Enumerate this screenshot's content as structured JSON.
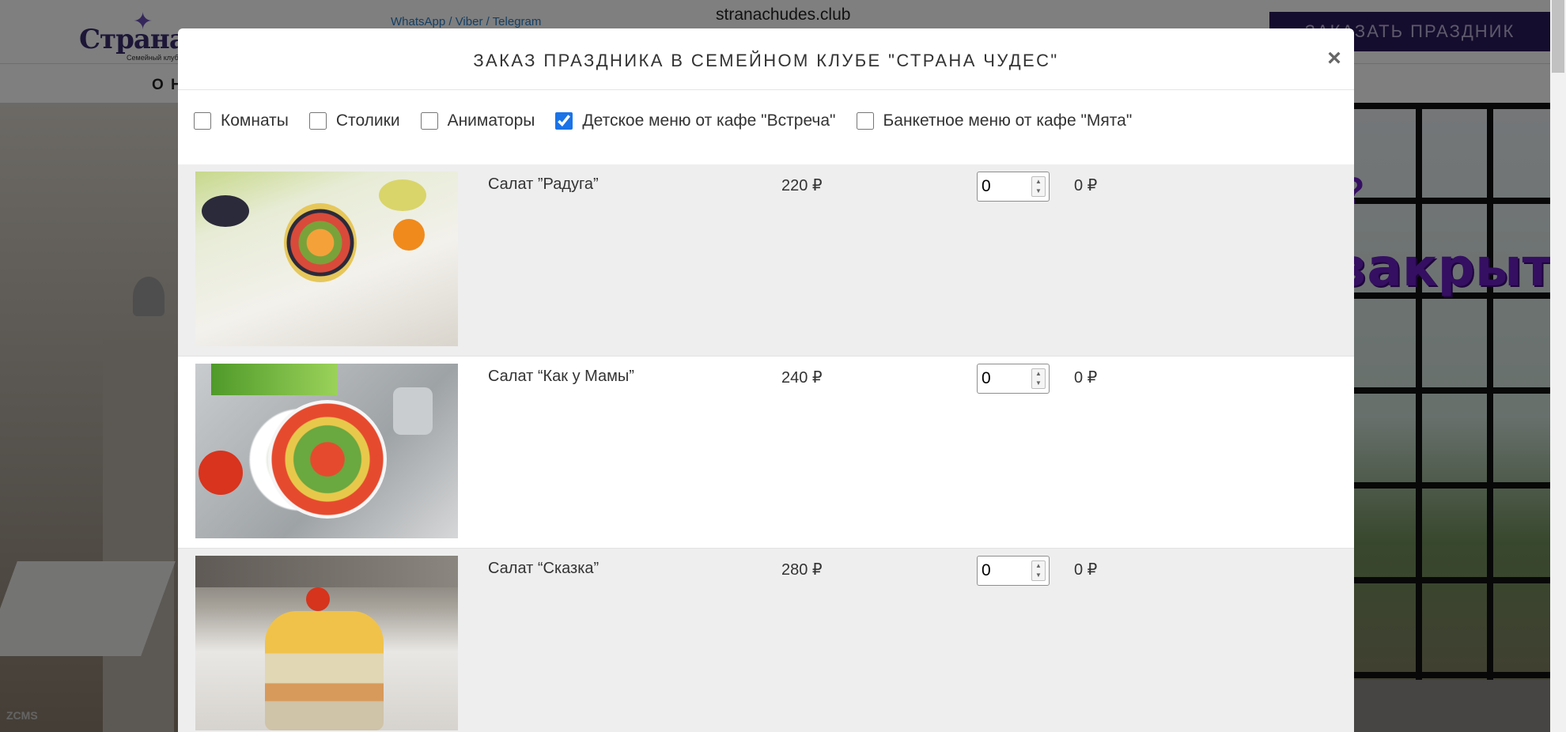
{
  "site": {
    "logo_text": "СтранаЧудес",
    "logo_sub": "Семейный клуб",
    "contacts": "WhatsApp / Viber / Telegram",
    "domain": "stranachudes.club",
    "order_button": "ЗАКАЗАТЬ ПРАЗДНИК",
    "nav_first": "О Н",
    "hero_sign": "закрыт",
    "footer_mark": "ZCMS"
  },
  "modal": {
    "title": "ЗАКАЗ ПРАЗДНИКА В СЕМЕЙНОМ КЛУБЕ \"СТРАНА ЧУДЕС\"",
    "close": "×",
    "filters": [
      {
        "label": "Комнаты",
        "checked": false
      },
      {
        "label": "Столики",
        "checked": false
      },
      {
        "label": "Аниматоры",
        "checked": false
      },
      {
        "label": "Детское меню от кафе \"Встреча\"",
        "checked": true
      },
      {
        "label": "Банкетное меню от кафе \"Мята\"",
        "checked": false
      }
    ],
    "items": [
      {
        "name": "Салат ”Радуга”",
        "price": "220 ₽",
        "quantity": "0",
        "total": "0 ₽"
      },
      {
        "name": "Салат “Как у Мамы”",
        "price": "240 ₽",
        "quantity": "0",
        "total": "0 ₽"
      },
      {
        "name": "Салат “Сказка”",
        "price": "280 ₽",
        "quantity": "0",
        "total": "0 ₽"
      }
    ]
  },
  "colors": {
    "accent": "#1a73e8",
    "order_button_bg": "#2b1b5a",
    "link": "#2a7ec8",
    "hero_sign": "#6b1fc4"
  },
  "icons": {
    "close": "close-icon",
    "spin_up": "chevron-up-icon",
    "spin_down": "chevron-down-icon"
  }
}
